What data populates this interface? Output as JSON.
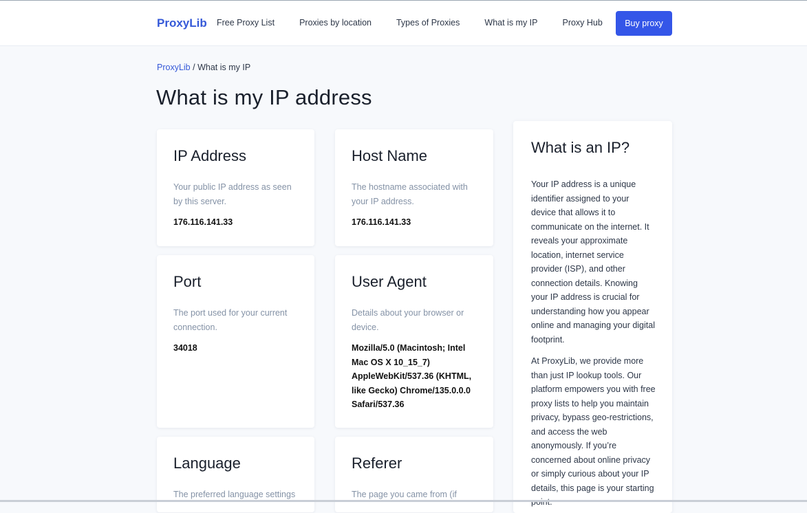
{
  "header": {
    "logo": "ProxyLib",
    "nav": [
      "Free Proxy List",
      "Proxies by location",
      "Types of Proxies",
      "What is my IP",
      "Proxy Hub"
    ],
    "buy_label": "Buy proxy"
  },
  "breadcrumb": {
    "home": "ProxyLib",
    "separator": " / ",
    "current": "What is my IP"
  },
  "page_title": "What is my IP address",
  "cards": {
    "ip": {
      "title": "IP Address",
      "desc": "Your public IP address as seen by this server.",
      "value": "176.116.141.33"
    },
    "host": {
      "title": "Host Name",
      "desc": "The hostname associated with your IP address.",
      "value": "176.116.141.33"
    },
    "port": {
      "title": "Port",
      "desc": "The port used for your current connection.",
      "value": "34018"
    },
    "ua": {
      "title": "User Agent",
      "desc": "Details about your browser or device.",
      "value": "Mozilla/5.0 (Macintosh; Intel Mac OS X 10_15_7) AppleWebKit/537.36 (KHTML, like Gecko) Chrome/135.0.0.0 Safari/537.36"
    },
    "lang": {
      "title": "Language",
      "desc": "The preferred language settings"
    },
    "ref": {
      "title": "Referer",
      "desc": "The page you came from (if"
    }
  },
  "sidebar": {
    "title": "What is an IP?",
    "p1": "Your IP address is a unique identifier assigned to your device that allows it to communicate on the internet. It reveals your approximate location, internet service provider (ISP), and other connection details. Knowing your IP address is crucial for understanding how you appear online and managing your digital footprint.",
    "p2": "At ProxyLib, we provide more than just IP lookup tools. Our platform empowers you with free proxy lists to help you maintain privacy, bypass geo-restrictions, and access the web anonymously. If you’re concerned about online privacy or simply curious about your IP details, this page is your starting point."
  },
  "colors": {
    "accent": "#3456e8",
    "link": "#3559d8",
    "muted": "#8492a6",
    "background": "#f7f9fc"
  }
}
